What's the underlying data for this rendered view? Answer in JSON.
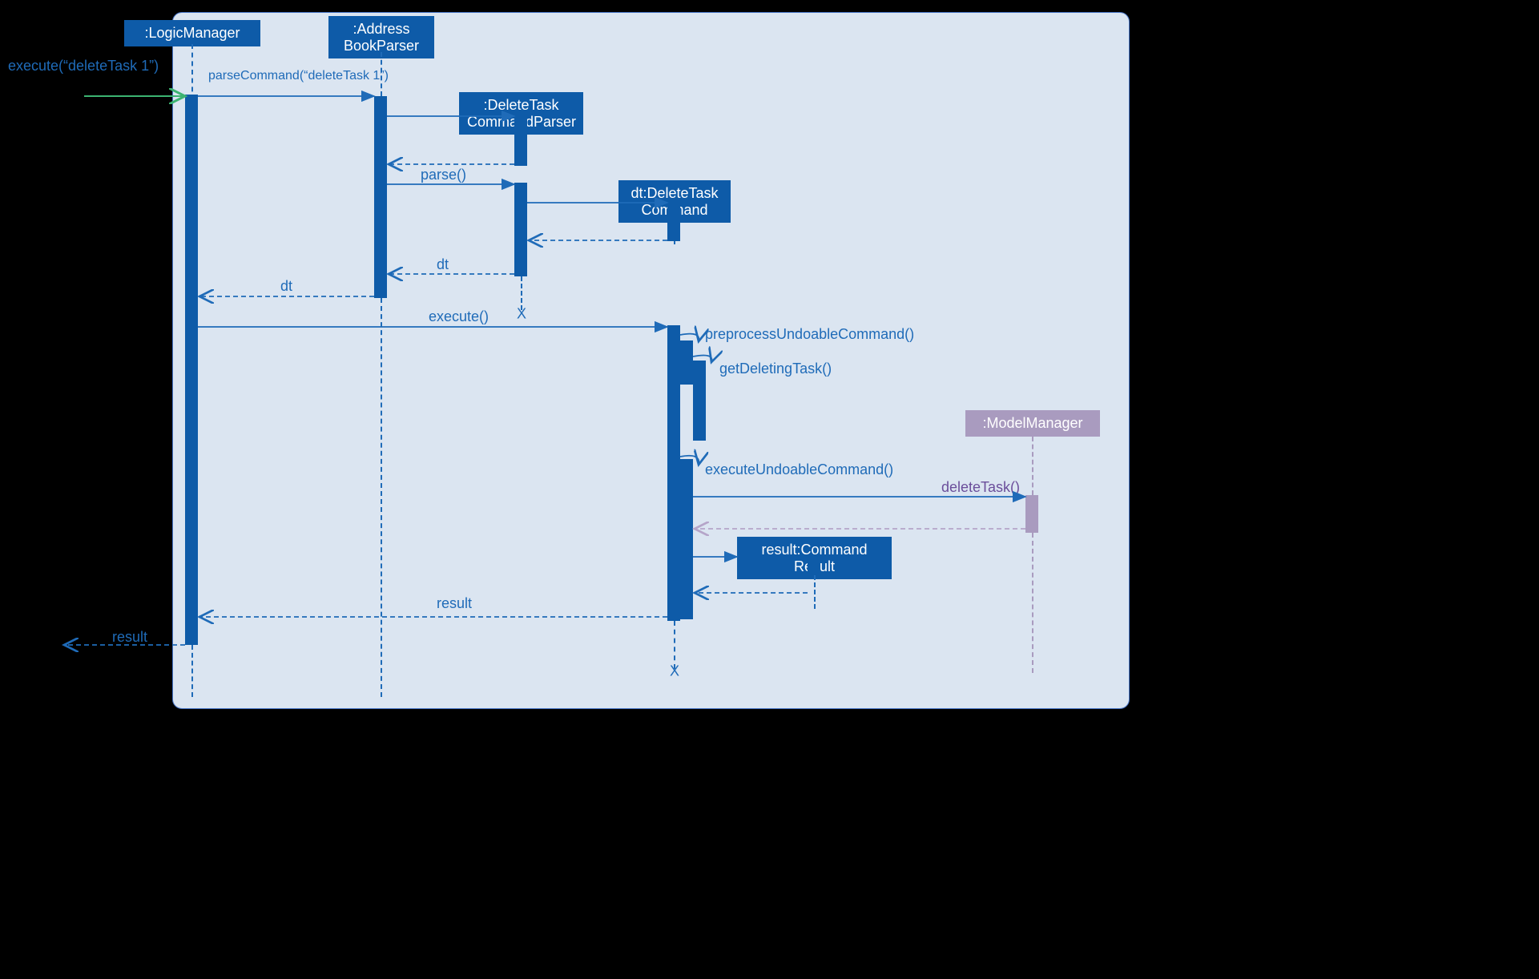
{
  "participants": {
    "logic_manager": ":LogicManager",
    "address_book_parser": ":Address\nBookParser",
    "delete_task_command_parser": ":DeleteTask\nCommandParser",
    "delete_task_command": "dt:DeleteTask\nCommand",
    "model_manager": ":ModelManager",
    "command_result": "result:Command\nResult"
  },
  "messages": {
    "execute_cmd": "execute(“deleteTask 1”)",
    "parse_command": "parseCommand(“deleteTask 1”)",
    "parse": "parse()",
    "dt_return1": "dt",
    "dt_return2": "dt",
    "execute": "execute()",
    "preprocess": "preprocessUndoableCommand()",
    "get_deleting": "getDeletingTask()",
    "execute_undoable": "executeUndoableCommand()",
    "delete_task": "deleteTask()",
    "result_return": "result",
    "result_out": "result"
  },
  "colors": {
    "blue": "#1f6bb8",
    "darkblue": "#0e5ba8",
    "purple": "#a99bbf",
    "purpletext": "#6b4e9b",
    "green": "#188038",
    "frame": "#dbe5f1"
  }
}
